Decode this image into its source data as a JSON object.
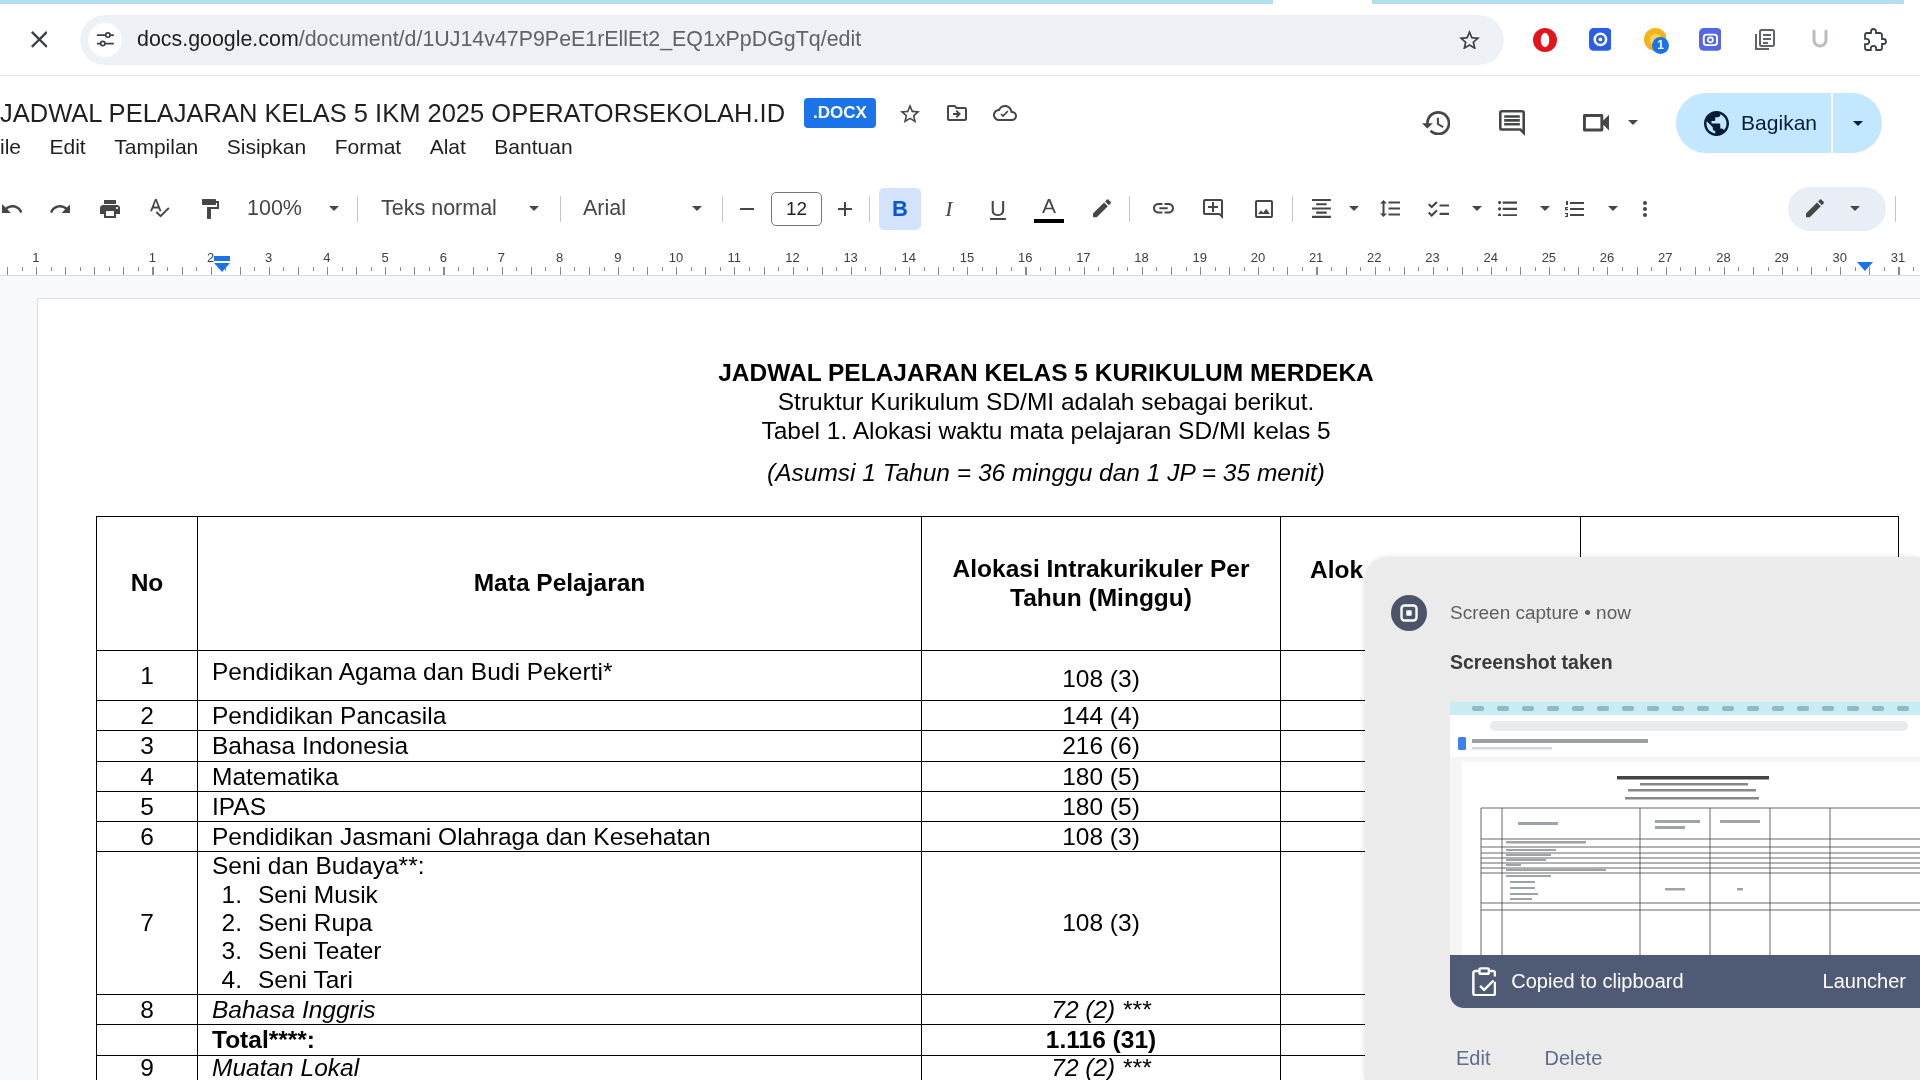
{
  "browser": {
    "url_host": "docs.google.com",
    "url_path": "/document/d/1UJ14v47P9PeE1rEllEt2_EQ1xPpDGgTq/edit",
    "extension_badge": "1"
  },
  "doc_header": {
    "title": "JADWAL PELAJARAN KELAS 5 IKM 2025 OPERATORSEKOLAH.ID",
    "file_badge": ".DOCX",
    "menu": [
      "ile",
      "Edit",
      "Tampilan",
      "Sisipkan",
      "Format",
      "Alat",
      "Bantuan"
    ],
    "share_button": "Bagikan"
  },
  "toolbar": {
    "zoom": "100%",
    "paragraph_style": "Teks normal",
    "font": "Arial",
    "font_size": "12",
    "format_buttons": [
      {
        "kind": "bold",
        "label": "B",
        "selected": true
      },
      {
        "kind": "italic",
        "label": "I",
        "selected": false
      },
      {
        "kind": "underline",
        "label": "U",
        "selected": false
      }
    ],
    "text_color_label": "A"
  },
  "ruler": {
    "left_numbers": [
      "1"
    ],
    "right_numbers": [
      "1",
      "2",
      "3",
      "4",
      "5",
      "6",
      "7",
      "8",
      "9",
      "10",
      "11",
      "12",
      "13",
      "14",
      "15",
      "16",
      "17",
      "18",
      "19",
      "20",
      "21",
      "22",
      "23",
      "24",
      "25",
      "26",
      "27",
      "28",
      "29",
      "30",
      "31"
    ]
  },
  "document": {
    "paragraphs": [
      {
        "kind": "heading",
        "text": "JADWAL PELAJARAN KELAS 5 KURIKULUM MERDEKA"
      },
      {
        "kind": "body",
        "text": "Struktur Kurikulum SD/MI adalah sebagai berikut."
      },
      {
        "kind": "body",
        "text": "Tabel 1. Alokasi waktu mata pelajaran SD/MI kelas 5"
      },
      {
        "kind": "note",
        "text": "(Asumsi 1 Tahun = 36 minggu dan 1 JP = 35 menit)"
      }
    ],
    "table": {
      "columns": [
        "No",
        "Mata Pelajaran",
        "Alokasi Intrakurikuler Per Tahun (Minggu)",
        "Alok"
      ],
      "rows": [
        {
          "kind": "subject",
          "no": "1",
          "subject": "Pendidikan Agama dan Budi Pekerti*",
          "weeks": "108 (3)"
        },
        {
          "kind": "subject",
          "no": "2",
          "subject": "Pendidikan Pancasila",
          "weeks": "144 (4)"
        },
        {
          "kind": "subject",
          "no": "3",
          "subject": "Bahasa Indonesia",
          "weeks": "216 (6)"
        },
        {
          "kind": "subject",
          "no": "4",
          "subject": "Matematika",
          "weeks": "180 (5)"
        },
        {
          "kind": "subject",
          "no": "5",
          "subject": "IPAS",
          "weeks": "180 (5)"
        },
        {
          "kind": "subject",
          "no": "6",
          "subject": "Pendidikan Jasmani Olahraga dan Kesehatan",
          "weeks": "108 (3)"
        },
        {
          "kind": "group",
          "no": "7",
          "subject": "Seni dan Budaya**:",
          "items": [
            {
              "number": "1.",
              "text": "Seni Musik"
            },
            {
              "number": "2.",
              "text": "Seni Rupa"
            },
            {
              "number": "3.",
              "text": "Seni Teater"
            },
            {
              "number": "4.",
              "text": "Seni Tari"
            }
          ],
          "weeks": "108 (3)"
        },
        {
          "kind": "elective",
          "no": "8",
          "subject": "Bahasa Inggris",
          "weeks": "72 (2) ***"
        },
        {
          "kind": "total",
          "subject": "Total****:",
          "weeks": "1.116 (31)"
        },
        {
          "kind": "elective",
          "no": "9",
          "subject": "Muatan Lokal",
          "weeks": "72 (2) ***"
        }
      ]
    }
  },
  "notification": {
    "source": "Screen capture • now",
    "title": "Screenshot taken",
    "banner_text": "Copied to clipboard",
    "banner_action": "Launcher",
    "actions": [
      "Edit",
      "Delete"
    ]
  }
}
